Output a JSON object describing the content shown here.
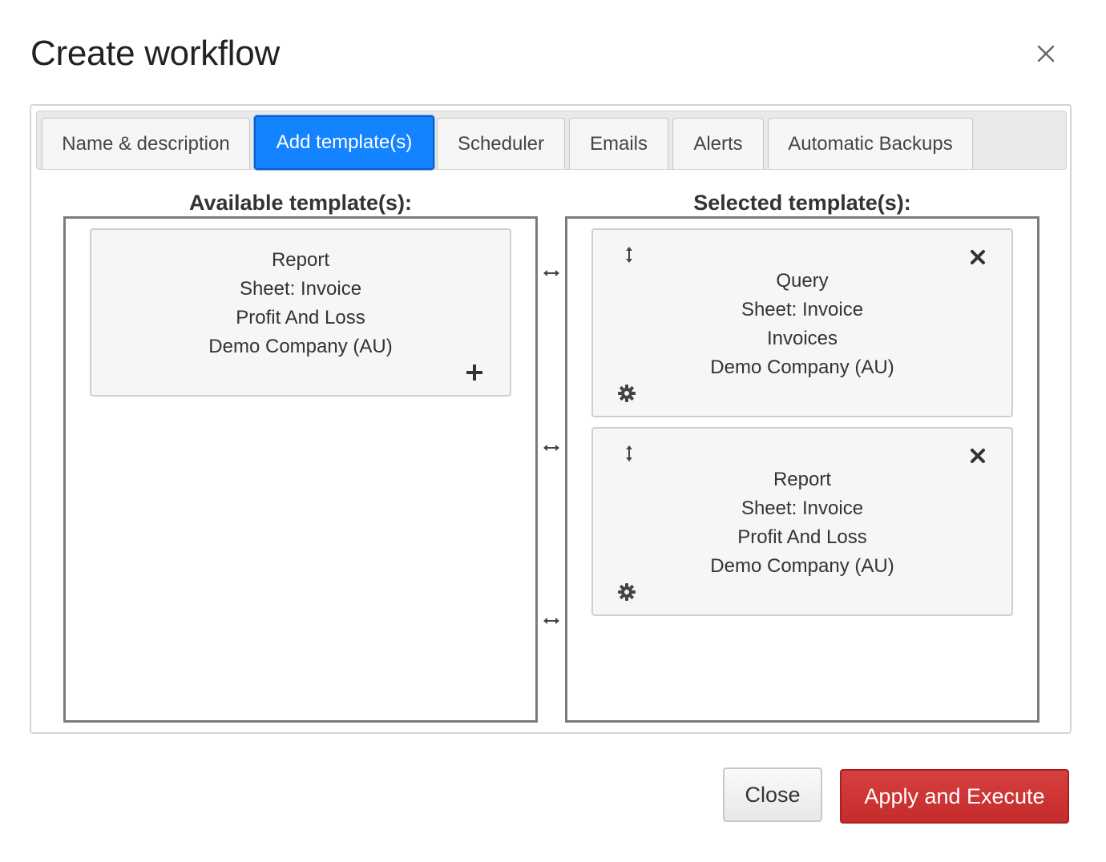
{
  "dialog": {
    "title": "Create workflow"
  },
  "tabs": [
    {
      "label": "Name & description"
    },
    {
      "label": "Add template(s)"
    },
    {
      "label": "Scheduler"
    },
    {
      "label": "Emails"
    },
    {
      "label": "Alerts"
    },
    {
      "label": "Automatic Backups"
    }
  ],
  "active_tab": "Add template(s)",
  "available": {
    "title": "Available template(s):",
    "items": [
      {
        "lines": [
          "Report",
          "Sheet: Invoice",
          "Profit And Loss",
          "Demo Company (AU)"
        ],
        "action_icon": "plus-icon"
      }
    ]
  },
  "selected": {
    "title": "Selected template(s):",
    "items": [
      {
        "lines": [
          "Query",
          "Sheet: Invoice",
          "Invoices",
          "Demo Company (AU)"
        ],
        "icons": [
          "vertical-move-icon",
          "remove-icon",
          "gear-icon"
        ]
      },
      {
        "lines": [
          "Report",
          "Sheet: Invoice",
          "Profit And Loss",
          "Demo Company (AU)"
        ],
        "icons": [
          "vertical-move-icon",
          "remove-icon",
          "gear-icon"
        ]
      }
    ]
  },
  "transfer_icons": [
    "horizontal-move-icon",
    "horizontal-move-icon",
    "horizontal-move-icon"
  ],
  "footer": {
    "close_label": "Close",
    "apply_label": "Apply and Execute"
  },
  "colors": {
    "active_tab": "#1483ff",
    "apply_button": "#c9302c"
  }
}
